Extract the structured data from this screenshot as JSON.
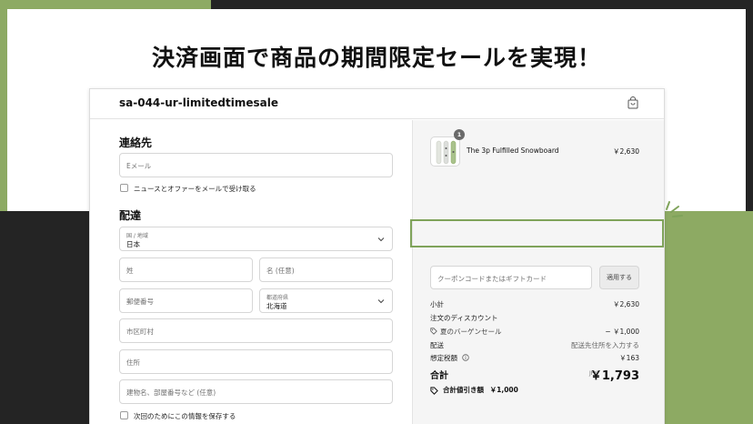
{
  "headline": "決済画面で商品の期間限定セールを実現！",
  "store": {
    "name": "sa-044-ur-limitedtimesale"
  },
  "icons": {
    "bag": "shopping-bag-icon",
    "chevron": "chevron-down-icon",
    "tag": "tag-icon",
    "info": "info-icon"
  },
  "contact": {
    "title": "連絡先",
    "email_placeholder": "Eメール",
    "newsletter_label": "ニュースとオファーをメールで受け取る"
  },
  "delivery": {
    "title": "配達",
    "country_label": "国 / 地域",
    "country_value": "日本",
    "last_name_placeholder": "姓",
    "first_name_placeholder": "名 (任意)",
    "postal_placeholder": "郵便番号",
    "prefecture_label": "都道府県",
    "prefecture_value": "北海道",
    "city_placeholder": "市区町村",
    "address_placeholder": "住所",
    "building_placeholder": "建物名、部屋番号など (任意)",
    "save_info_label": "次回のためにこの情報を保存する"
  },
  "summary": {
    "product": {
      "quantity": "1",
      "name": "The 3p Fulfilled Snowboard",
      "price": "￥2,630"
    },
    "coupon_placeholder": "クーポンコードまたはギフトカード",
    "apply_label": "適用する",
    "subtotal_label": "小計",
    "subtotal_value": "￥2,630",
    "order_discount_label": "注文のディスカウント",
    "discount_name": "夏のバーゲンセール",
    "discount_value": "− ￥1,000",
    "shipping_label": "配送",
    "shipping_value": "配送先住所を入力する",
    "tax_label": "想定税額",
    "tax_value": "￥163",
    "total_label": "合計",
    "currency": "JPY",
    "total_value": "￥1,793",
    "savings_label": "合計値引き額",
    "savings_value": "￥1,000"
  },
  "colors": {
    "accent_green": "#8daa63",
    "highlight_border": "#7fa35a",
    "dark_block": "#242424"
  }
}
